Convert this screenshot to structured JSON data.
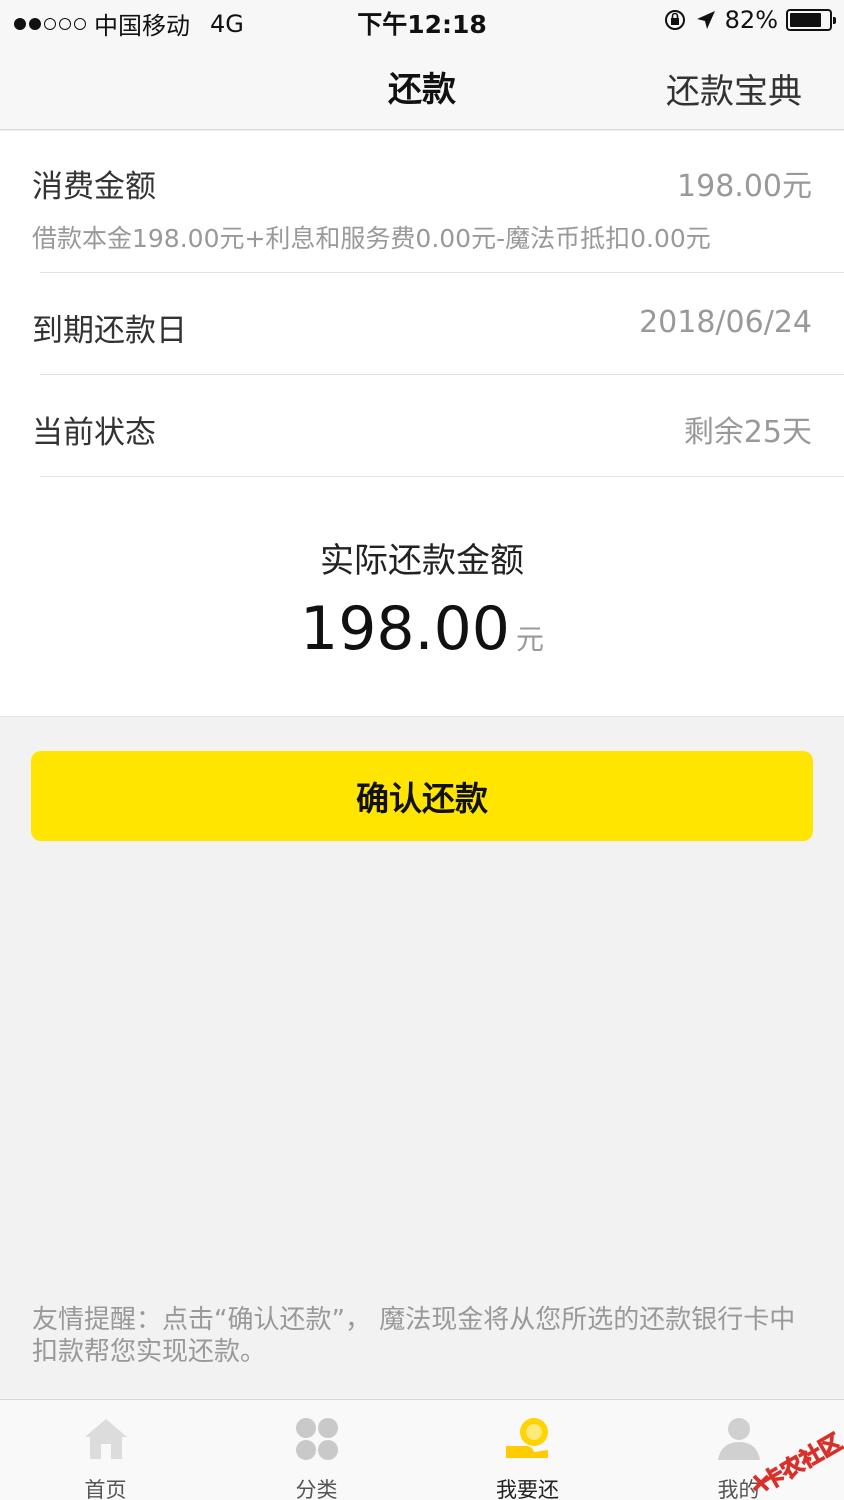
{
  "status_bar": {
    "carrier": "中国移动",
    "network": "4G",
    "time": "下午12:18",
    "battery": "82%",
    "battery_level": 0.82
  },
  "nav": {
    "title": "还款",
    "right_link": "还款宝典"
  },
  "bill": {
    "amount_label": "消费金额",
    "amount_value": "198.00元",
    "breakdown": "借款本金198.00元+利息和服务费0.00元-魔法币抵扣0.00元",
    "due_label": "到期还款日",
    "due_value": "2018/06/24",
    "status_label": "当前状态",
    "status_value": "剩余25天"
  },
  "actual": {
    "label": "实际还款金额",
    "amount": "198.00",
    "unit": "元"
  },
  "confirm_button": "确认还款",
  "reminder": "友情提醒：点击“确认还款”， 魔法现金将从您所选的还款银行卡中扣款帮您实现还款。",
  "tabs": [
    {
      "label": "首页",
      "icon": "home-icon"
    },
    {
      "label": "分类",
      "icon": "category-icon"
    },
    {
      "label": "我要还",
      "icon": "repay-coin-icon",
      "active": true
    },
    {
      "label": "我的",
      "icon": "profile-icon"
    }
  ],
  "watermark": "卡农社区",
  "colors": {
    "accent": "#ffe500",
    "background": "#f2f2f2",
    "muted_text": "#999999"
  }
}
